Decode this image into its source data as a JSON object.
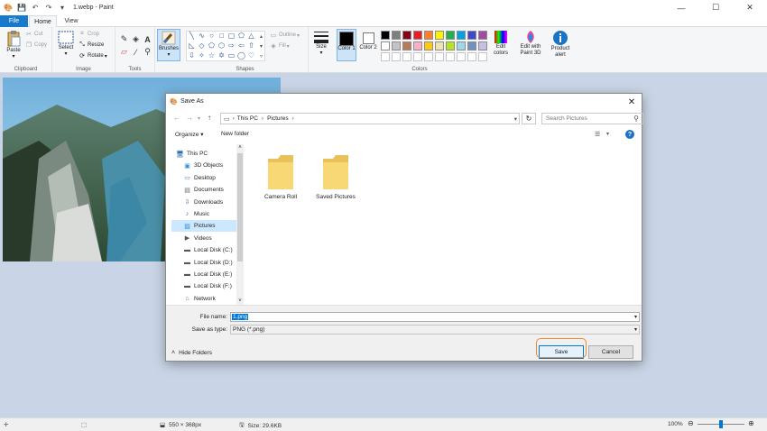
{
  "app": {
    "title": "1.webp - Paint",
    "tabs": {
      "file": "File",
      "home": "Home",
      "view": "View"
    },
    "window_controls": {
      "minimize": "—",
      "maximize": "☐",
      "close": "✕"
    }
  },
  "ribbon": {
    "clipboard": {
      "paste": "Paste",
      "cut": "Cut",
      "copy": "Copy",
      "label": "Clipboard"
    },
    "image": {
      "select": "Select",
      "crop": "Crop",
      "resize": "Resize",
      "rotate": "Rotate",
      "label": "Image"
    },
    "tools": {
      "label": "Tools",
      "brushes": "Brushes"
    },
    "shapes": {
      "outline": "Outline",
      "fill": "Fill",
      "label": "Shapes"
    },
    "size": {
      "label": "Size"
    },
    "colors": {
      "color1": "Color 1",
      "color2": "Color 2",
      "edit_colors": "Edit colors",
      "edit_with_paint3d": "Edit with Paint 3D",
      "product_alert": "Product alert",
      "label": "Colors",
      "palette_row1": [
        "#000000",
        "#7f7f7f",
        "#880015",
        "#ed1c24",
        "#ff7f27",
        "#fff200",
        "#22b14c",
        "#00a2e8",
        "#3f48cc",
        "#a349a4"
      ],
      "palette_row2": [
        "#ffffff",
        "#c3c3c3",
        "#b97a57",
        "#ffaec9",
        "#ffc90e",
        "#efe4b0",
        "#b5e61d",
        "#99d9ea",
        "#7092be",
        "#c8bfe7"
      ]
    }
  },
  "dialog": {
    "title": "Save As",
    "close": "✕",
    "breadcrumb": [
      "This PC",
      "Pictures"
    ],
    "search_placeholder": "Search Pictures",
    "organize": "Organize",
    "new_folder": "New folder",
    "help": "?",
    "nav": [
      {
        "label": "This PC",
        "icon": "computer-icon"
      },
      {
        "label": "3D Objects",
        "icon": "cube-icon"
      },
      {
        "label": "Desktop",
        "icon": "desktop-icon"
      },
      {
        "label": "Documents",
        "icon": "document-icon"
      },
      {
        "label": "Downloads",
        "icon": "download-icon"
      },
      {
        "label": "Music",
        "icon": "music-icon"
      },
      {
        "label": "Pictures",
        "icon": "picture-icon",
        "selected": true
      },
      {
        "label": "Videos",
        "icon": "video-icon"
      },
      {
        "label": "Local Disk (C:)",
        "icon": "drive-icon"
      },
      {
        "label": "Local Disk (D:)",
        "icon": "drive-icon"
      },
      {
        "label": "Local Disk (E:)",
        "icon": "drive-icon"
      },
      {
        "label": "Local Disk (F:)",
        "icon": "drive-icon"
      },
      {
        "label": "Network",
        "icon": "network-icon"
      }
    ],
    "folders": [
      "Camera Roll",
      "Saved Pictures"
    ],
    "file_name_label": "File name:",
    "file_name_value": "1.png",
    "save_type_label": "Save as type:",
    "save_type_value": "PNG (*.png)",
    "hide_folders": "Hide Folders",
    "save": "Save",
    "cancel": "Cancel",
    "highlight_color": "#f08a24"
  },
  "status": {
    "dimensions": "550 × 368px",
    "size": "Size: 29.6KB",
    "zoom": "100%",
    "zoom_fraction": 0.5
  }
}
